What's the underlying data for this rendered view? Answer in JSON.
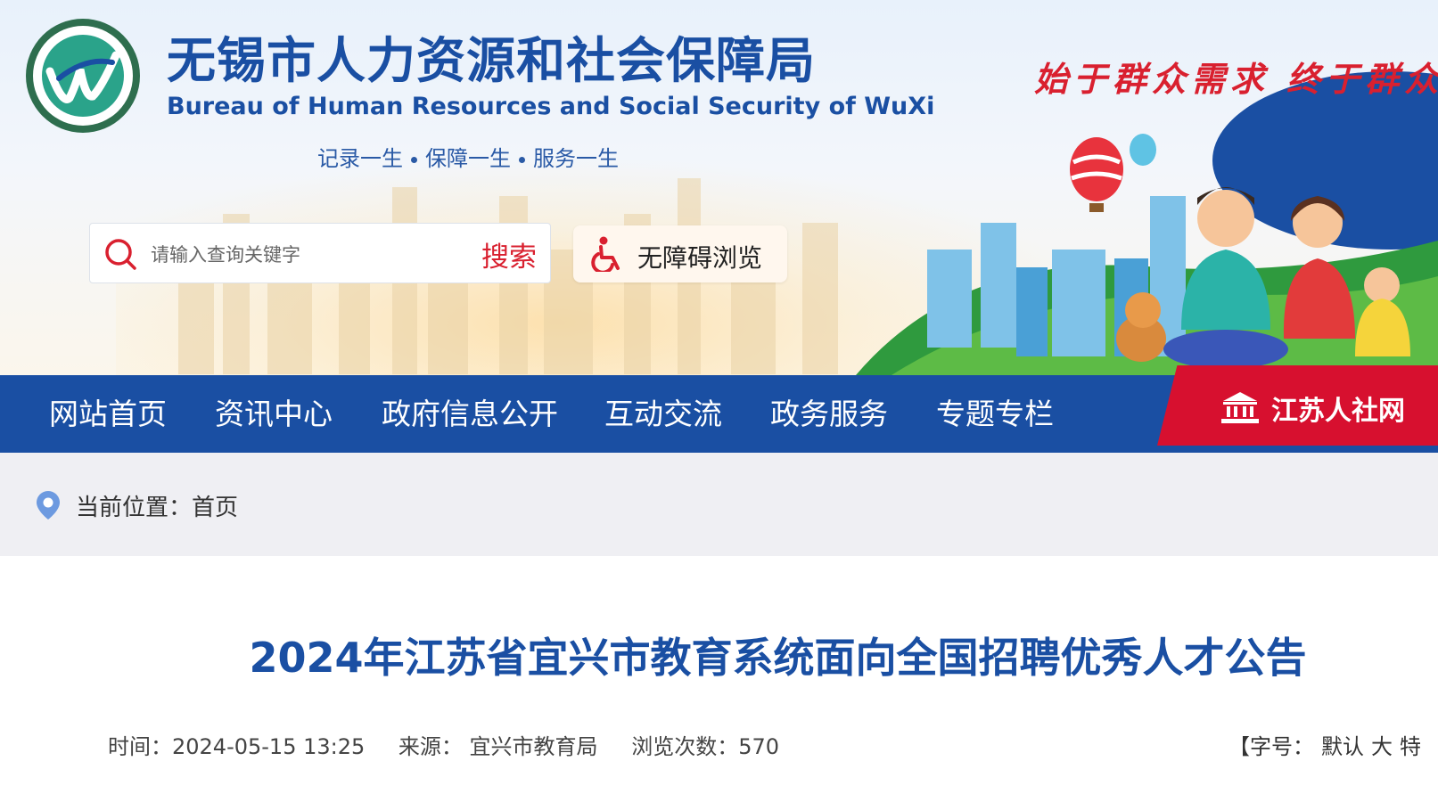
{
  "header": {
    "site_title": "无锡市人力资源和社会保障局",
    "site_subtitle": "Bureau of  Human Resources and Social Security of WuXi",
    "tagline": [
      "记录一生",
      "保障一生",
      "服务一生"
    ],
    "slogan": "始于群众需求  终于群众",
    "colors": {
      "brand_blue": "#1a4fa3",
      "accent_red": "#d9202f"
    }
  },
  "search": {
    "placeholder": "请输入查询关键字",
    "button_label": "搜索",
    "icon": "search-icon"
  },
  "accessibility": {
    "label": "无障碍浏览",
    "icon": "wheelchair-icon"
  },
  "nav": {
    "items": [
      {
        "label": "网站首页"
      },
      {
        "label": "资讯中心"
      },
      {
        "label": "政府信息公开"
      },
      {
        "label": "互动交流"
      },
      {
        "label": "政务服务"
      },
      {
        "label": "专题专栏"
      }
    ],
    "external_label": "江苏人社网",
    "external_icon": "government-building-icon"
  },
  "breadcrumb": {
    "text": "当前位置：首页",
    "icon": "location-pin-icon"
  },
  "article": {
    "title": "2024年江苏省宜兴市教育系统面向全国招聘优秀人才公告",
    "time_label": "时间：2024-05-15 13:25",
    "source_label": "来源：  宜兴市教育局",
    "views_label": "浏览次数：570",
    "font_size": {
      "prefix": "【字号：",
      "options": [
        "默认",
        "大",
        "特"
      ]
    }
  }
}
